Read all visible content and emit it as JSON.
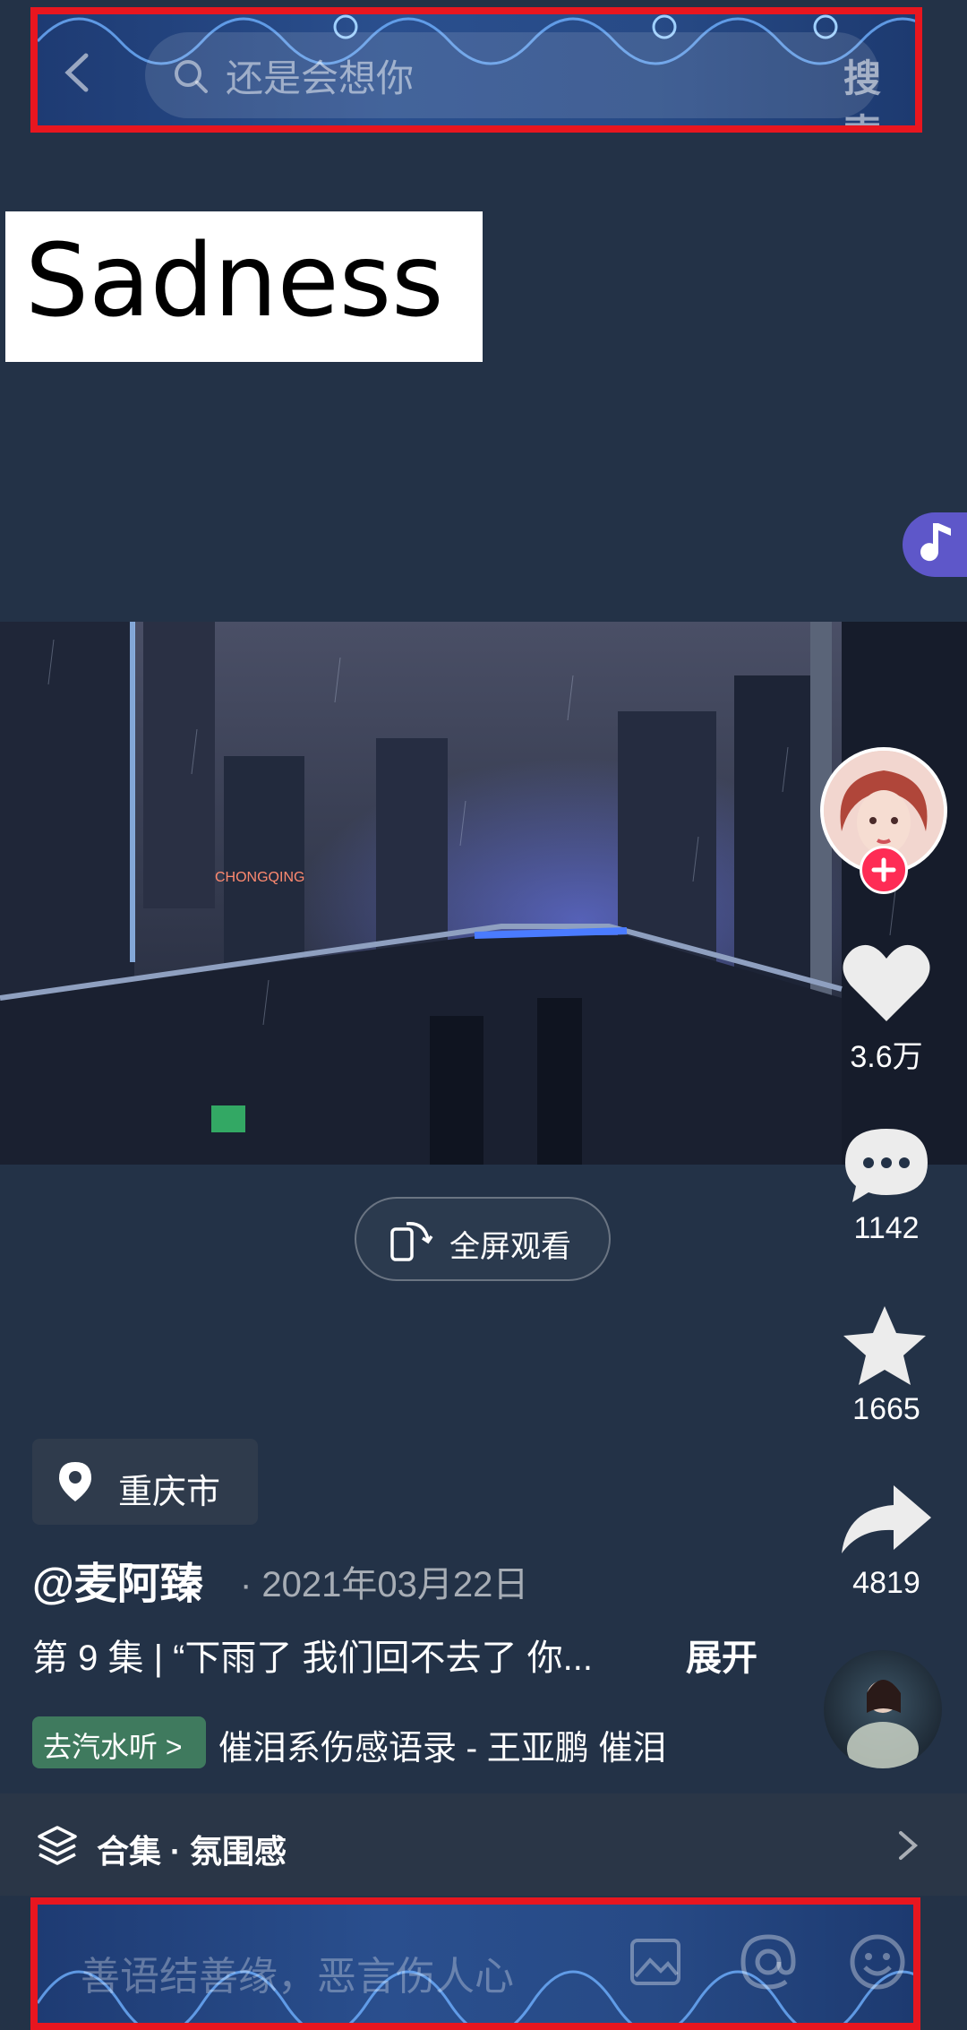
{
  "search": {
    "query": "还是会想你",
    "button_label": "搜索"
  },
  "overlay_caption": "Sadness",
  "player": {
    "fullscreen_label": "全屏观看"
  },
  "actions": {
    "likes": "3.6万",
    "comments": "1142",
    "favorites": "1665",
    "shares": "4819"
  },
  "post": {
    "location": "重庆市",
    "author": "@麦阿臻",
    "date": "· 2021年03月22日",
    "description": "第 9 集 | “下雨了 我们回不去了 你...",
    "expand_label": "展开",
    "music_chip": "去汽水听 >",
    "song": "催泪系伤感语录 - 王亚鹏     催泪"
  },
  "collection": {
    "label": "合集 · 氛围感"
  },
  "comment_bar": {
    "placeholder": "善语结善缘，恶言伤人心"
  },
  "colors": {
    "background": "#233247",
    "accent_red": "#fe2c55",
    "annotation_border": "#e8161f",
    "music_tab": "#5e57c9",
    "qishui_chip": "#3f7a5e"
  },
  "icons": [
    "back-icon",
    "search-icon",
    "music-note-icon",
    "fullscreen-rotate-icon",
    "heart-icon",
    "comment-icon",
    "star-icon",
    "share-icon",
    "location-pin-icon",
    "collection-layers-icon",
    "chevron-right-icon",
    "image-icon",
    "at-icon",
    "emoji-icon"
  ]
}
